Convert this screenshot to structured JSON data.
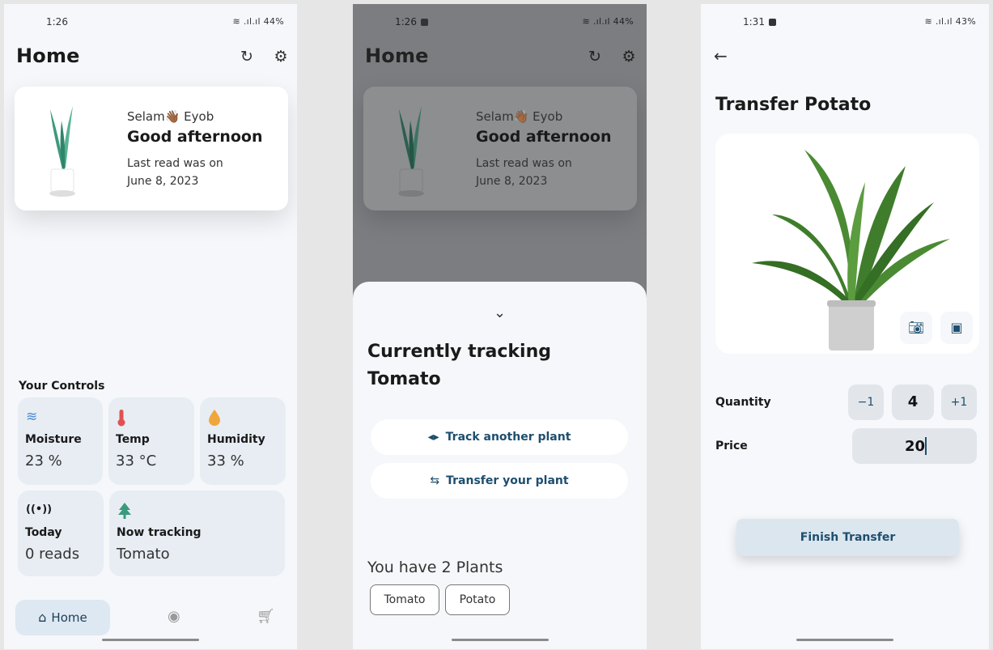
{
  "home": {
    "status": {
      "time": "1:26",
      "battery": "44%"
    },
    "title": "Home",
    "greeting": {
      "name": "Selam👋🏾 Eyob",
      "hello": "Good afternoon",
      "last_read_1": "Last read was on",
      "last_read_2": "June 8, 2023"
    },
    "controls_title": "Your Controls",
    "tiles": [
      {
        "icon": "water-waves-icon",
        "label": "Moisture",
        "value": "23 %"
      },
      {
        "icon": "thermometer-icon",
        "label": "Temp",
        "value": "33 °C"
      },
      {
        "icon": "droplet-icon",
        "label": "Humidity",
        "value": "33 %"
      },
      {
        "icon": "signal-broadcast-icon",
        "label": "Today",
        "value": "0 reads"
      },
      {
        "icon": "tree-icon",
        "label": "Now tracking",
        "value": "Tomato"
      }
    ],
    "nav": {
      "home_label": "Home"
    },
    "colors": {
      "tile_bg": "#e7edf3",
      "accent": "#1d4e6e",
      "nav_active": "#dde8f2"
    }
  },
  "sheet_screen": {
    "status": {
      "time": "1:26",
      "battery": "44%"
    },
    "title": "Home",
    "greeting": {
      "name": "Selam👋🏾 Eyob",
      "hello": "Good afternoon",
      "last_read_1": "Last read was on",
      "last_read_2": "June 8, 2023"
    },
    "sheet": {
      "title": "Currently tracking Tomato",
      "track_another": "Track another plant",
      "transfer": "Transfer your plant",
      "plants_count": "You have 2 Plants",
      "plants": [
        "Tomato",
        "Potato"
      ]
    }
  },
  "transfer": {
    "status": {
      "time": "1:31",
      "battery": "43%"
    },
    "title": "Transfer Potato",
    "quantity_label": "Quantity",
    "decrement": "−1",
    "quantity": "4",
    "increment": "+1",
    "price_label": "Price",
    "price": "20",
    "finish": "Finish Transfer"
  }
}
